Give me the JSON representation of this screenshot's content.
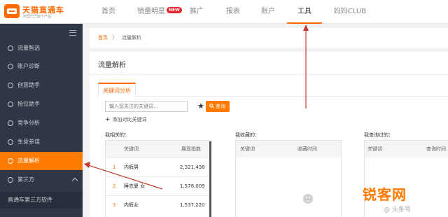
{
  "logo": {
    "title": "天猫直通车",
    "subtitle": "阿里巴巴旗下产品"
  },
  "nav": {
    "items": [
      {
        "label": "首页"
      },
      {
        "label": "销量明星",
        "badge": "NEW"
      },
      {
        "label": "推广"
      },
      {
        "label": "报表"
      },
      {
        "label": "账户"
      },
      {
        "label": "工具",
        "active": true
      },
      {
        "label": "妈妈CLUB"
      }
    ]
  },
  "sidebar": {
    "items": [
      {
        "label": "流量智选",
        "icon": "compass-icon"
      },
      {
        "label": "账户诊断",
        "icon": "search-icon"
      },
      {
        "label": "创意助手",
        "icon": "bulb-icon"
      },
      {
        "label": "抢位助手",
        "icon": "target-icon"
      },
      {
        "label": "竞争分析",
        "icon": "bar-chart-icon"
      },
      {
        "label": "生意参谋",
        "icon": "clock-icon"
      },
      {
        "label": "流量解析",
        "icon": "chart-icon",
        "active": true
      },
      {
        "label": "第三方",
        "icon": "circle-icon"
      }
    ],
    "sub_item": "直通车第三方软件"
  },
  "breadcrumb": {
    "home": "首页",
    "separator": "〉",
    "current": "流量解析"
  },
  "panel": {
    "title": "流量解析",
    "tab": "关键词分析",
    "search": {
      "placeholder": "输入您关注的关键词...",
      "button": "查询"
    },
    "add_compare": "添加对比关键词"
  },
  "related": {
    "title": "我相关的：",
    "headers": {
      "keyword": "关键词",
      "metric": "展现指数"
    },
    "rows": [
      {
        "rank": "1",
        "keyword": "内裤男",
        "value": "2,321,438"
      },
      {
        "rank": "2",
        "keyword": "睡衣夏 女",
        "value": "1,578,009"
      },
      {
        "rank": "3",
        "keyword": "内裤女",
        "value": "1,537,220"
      }
    ]
  },
  "favorites": {
    "title": "我收藏的：",
    "headers": {
      "keyword": "关键词",
      "time": "收藏时间"
    }
  },
  "history": {
    "title": "我查询过的：",
    "headers": {
      "keyword": "关键词",
      "time": "查询时间"
    }
  },
  "watermark": {
    "text": "锐客网",
    "sub": "@ 头条号"
  },
  "colors": {
    "accent": "#ff7a00",
    "sidebar_bg": "#2f3645",
    "annotation": "#c0392b"
  }
}
